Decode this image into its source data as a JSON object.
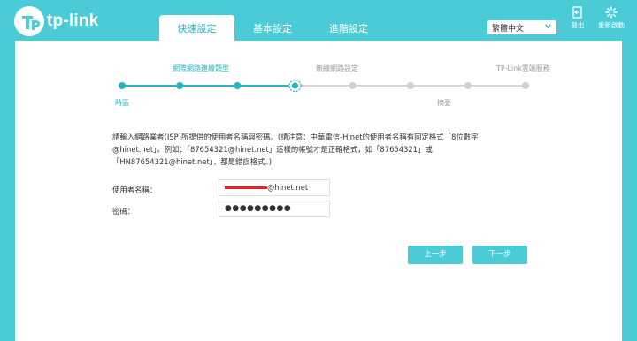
{
  "brand": {
    "name": "tp-link"
  },
  "tabs": [
    {
      "label": "快速設定"
    },
    {
      "label": "基本設定"
    },
    {
      "label": "進階設定"
    }
  ],
  "language": {
    "selected": "繁體中文"
  },
  "toolbar": {
    "logout_label": "登出",
    "reboot_label": "重新啟動"
  },
  "wizard": {
    "steps_top": [
      "網際網路連線類型",
      "無線網路設定",
      "TP-Link雲端服務"
    ],
    "steps_bottom": [
      "時區",
      "摘要"
    ],
    "current_step": 3,
    "total_steps": 8
  },
  "form": {
    "description": "請輸入網路業者(ISP)所提供的使用者名稱與密碼。(請注意：中華電信-Hinet的使用者名稱有固定格式「8位數字@hinet.net」。例如：「87654321@hinet.net」這樣的帳號才是正確格式，如「87654321」或「HN87654321@hinet.net」，都是錯誤格式。)",
    "username_label": "使用者名稱：",
    "username_suffix": "@hinet.net",
    "password_label": "密碼：",
    "password_value": "●●●●●●●●●"
  },
  "buttons": {
    "back": "上一步",
    "next": "下一步"
  },
  "colors": {
    "accent": "#4acbd6",
    "accent_dark": "#2ab3c1",
    "redaction": "#e82222"
  }
}
